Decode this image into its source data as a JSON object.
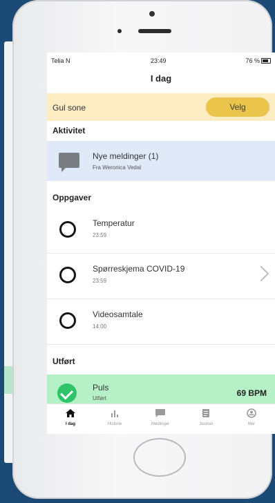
{
  "status_bar": {
    "carrier": "Telia N",
    "time": "23:49",
    "battery": "76 %"
  },
  "page_title": "I dag",
  "zone": {
    "label": "Gul sone",
    "button": "Velg"
  },
  "sections": {
    "activity": "Aktivitet",
    "tasks": "Oppgaver",
    "done": "Utført"
  },
  "message": {
    "title": "Nye meldinger (1)",
    "subtitle": "Fra Weronica Vedal"
  },
  "tasks": [
    {
      "title": "Temperatur",
      "time": "23:59"
    },
    {
      "title": "Spørreskjema COVID-19",
      "time": "23:59"
    },
    {
      "title": "Videosamtale",
      "time": "14:00"
    }
  ],
  "completed": {
    "title": "Puls",
    "status": "Utført",
    "value": "69 BPM"
  },
  "tabs": [
    {
      "label": "I dag",
      "icon": "home-icon"
    },
    {
      "label": "Historie",
      "icon": "bar-chart-icon"
    },
    {
      "label": "Meldinger",
      "icon": "chat-icon"
    },
    {
      "label": "Journal",
      "icon": "clipboard-icon"
    },
    {
      "label": "Mer",
      "icon": "user-circle-icon"
    }
  ],
  "colors": {
    "zone_bg": "#fbecc4",
    "zone_button": "#ebc54b",
    "message_bg": "#dfe9f8",
    "done_bg": "#b6f0c7",
    "check": "#2fc46a",
    "background": "#1b4a77"
  }
}
